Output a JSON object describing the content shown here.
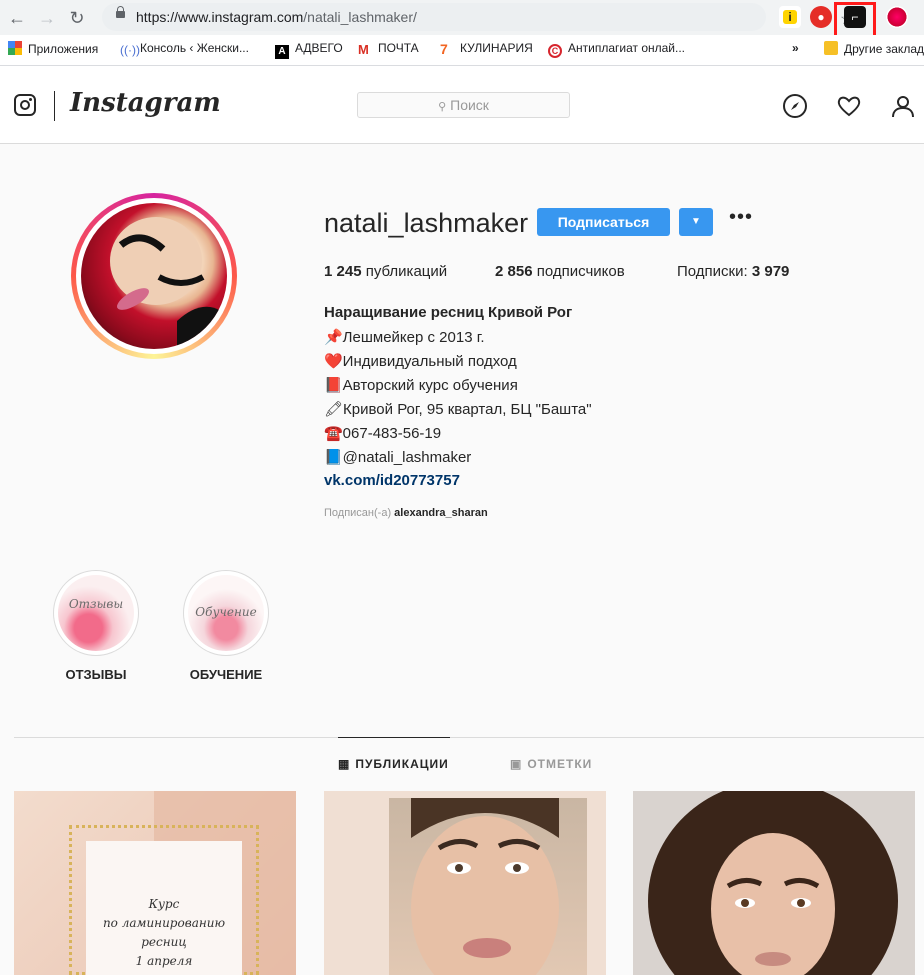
{
  "browser": {
    "url_host": "https://www.instagram.com",
    "url_path": "/natali_lashmaker/",
    "bookmarks": [
      {
        "label": "Приложения"
      },
      {
        "label": "Консоль ‹ Женски..."
      },
      {
        "label": "АДВЕГО"
      },
      {
        "label": "ПОЧТА"
      },
      {
        "label": "КУЛИНАРИЯ"
      },
      {
        "label": "Антиплагиат онлай..."
      },
      {
        "label": "Другие заклад"
      }
    ],
    "overflow": "»"
  },
  "header": {
    "wordmark": "Instagram",
    "search_placeholder": "Поиск"
  },
  "profile": {
    "username": "natali_lashmaker",
    "follow_label": "Подписаться",
    "posts_count": "1 245",
    "posts_label": "публикаций",
    "followers_count": "2 856",
    "followers_label": "подписчиков",
    "following_label": "Подписки:",
    "following_count": "3 979",
    "bio_name": "Наращивание ресниц Кривой Рог",
    "bio_lines": [
      "📌Лешмейкер с 2013 г.",
      "❤️Индивидуальный подход",
      "📕Авторский курс обучения",
      "🖍Кривой Рог, 95 квартал, БЦ \"Башта\"",
      "☎️067-483-56-19",
      "📘@natali_lashmaker"
    ],
    "link": "vk.com/id20773757",
    "followed_by_label": "Подписан(-а)",
    "followed_by_user": "alexandra_sharan"
  },
  "highlights": [
    {
      "label": "ОТЗЫВЫ",
      "cover_text": "Отзывы"
    },
    {
      "label": "ОБУЧЕНИЕ",
      "cover_text": "Обучение"
    }
  ],
  "tabs": [
    {
      "label": "ПУБЛИКАЦИИ",
      "active": true
    },
    {
      "label": "ОТМЕТКИ",
      "active": false
    }
  ],
  "posts": [
    {
      "caption_lines": [
        "Курс",
        "по ламинированию",
        "ресниц",
        "1 апреля"
      ]
    },
    {},
    {}
  ],
  "colors": {
    "accent": "#3897f0",
    "annotation": "#ff1a1a"
  }
}
